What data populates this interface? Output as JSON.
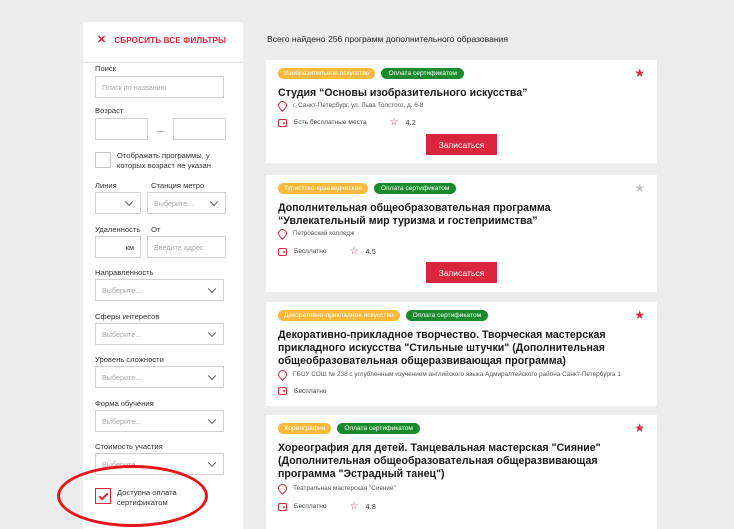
{
  "sidebar": {
    "reset_icon": "close-icon",
    "reset_label": "СБРОСИТЬ ВСЕ ФИЛЬТРЫ",
    "search_label": "Поиск",
    "search_placeholder": "Поиск по названию",
    "age_label": "Возраст",
    "age_separator": "—",
    "age_unknown_label": "Отображать программы, у которых возраст не указан",
    "line_label": "Линия",
    "station_label": "Станция метро",
    "station_placeholder": "Выберите...",
    "distance_label": "Удаленность",
    "distance_unit": "км",
    "from_label": "От",
    "from_placeholder": "Введите адрес",
    "direction_label": "Направленность",
    "direction_placeholder": "Выберите...",
    "interests_label": "Сферы интересов",
    "interests_placeholder": "Выберите...",
    "level_label": "Уровень сложности",
    "level_placeholder": "Выберите...",
    "form_label": "Форма обучения",
    "form_placeholder": "Выберите...",
    "cost_label": "Стоимость участия",
    "cost_placeholder": "Выберите...",
    "certificate_label": "Доступна оплата сертификатом"
  },
  "main": {
    "total_text": "Всего найдено 256 программ дополнительного образования",
    "enroll_label": "Записаться",
    "cards": [
      {
        "category": "Изобразительное искусство",
        "certificate_badge": "Оплата сертификатом",
        "favorite": true,
        "title": "Студия “Основы изобразительного искусства”",
        "address": "г. Санкт-Петербург, ул. Льва Толстого, д. 6-8",
        "price": "Есть бесплатные места",
        "rating": "4.2"
      },
      {
        "category": "Туристско-краеведческая",
        "certificate_badge": "Оплата сертификатом",
        "favorite": false,
        "title": "Дополнительная общеобразовательная программа “Увлекательный мир туризма и гостеприимства”",
        "address": "Петровский колледж",
        "price": "Бесплатно",
        "rating": "4.5"
      },
      {
        "category": "Декоративно-прикладное искусство",
        "certificate_badge": "Оплата сертификатом",
        "favorite": true,
        "title": "Декоративно-прикладное творчество. Творческая мастерская прикладного искусства \"Стильные штучки\" (Дополнительная общеобразовательная общеразвивающая программа)",
        "address": "ГБОУ СОШ № 238 с углубленным изучением английского языка Адмиралтейского района Санкт-Петербурга 1",
        "price": "Бесплатно"
      },
      {
        "category": "Хореография",
        "certificate_badge": "Оплата сертификатом",
        "favorite": true,
        "title": "Хореография для детей. Танцевальная мастерская \"Сияние\" (Дополнительная общеобразовательная общеразвивающая программа \"Эстрадный танец\")",
        "address": "Театральная мастерская \"Сияние\"",
        "price": "Бесплатно",
        "rating": "4.8"
      }
    ]
  },
  "colors": {
    "accent": "#d7263d",
    "badge_category": "#f6b93b",
    "badge_certificate": "#1a8a2d",
    "annotation": "#e8141c"
  }
}
